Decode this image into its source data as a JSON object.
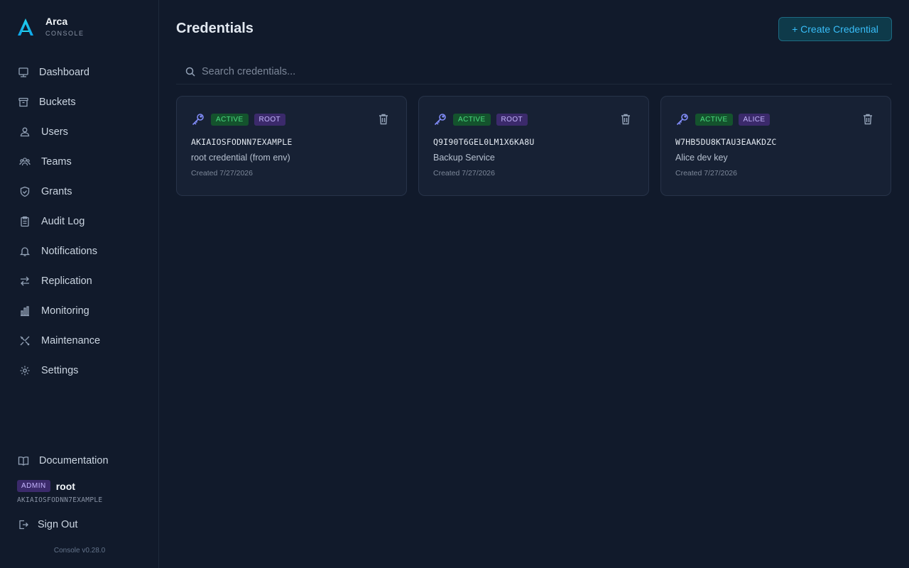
{
  "brand": {
    "name": "Arca",
    "subtitle": "CONSOLE"
  },
  "nav": {
    "items": [
      {
        "label": "Dashboard",
        "icon": "dashboard-icon"
      },
      {
        "label": "Buckets",
        "icon": "archive-icon"
      },
      {
        "label": "Users",
        "icon": "user-icon"
      },
      {
        "label": "Teams",
        "icon": "teams-icon"
      },
      {
        "label": "Grants",
        "icon": "shield-check-icon"
      },
      {
        "label": "Audit Log",
        "icon": "clipboard-icon"
      },
      {
        "label": "Notifications",
        "icon": "bell-icon"
      },
      {
        "label": "Replication",
        "icon": "arrows-icon"
      },
      {
        "label": "Monitoring",
        "icon": "bar-chart-icon"
      },
      {
        "label": "Maintenance",
        "icon": "tools-icon"
      },
      {
        "label": "Settings",
        "icon": "gear-icon"
      }
    ]
  },
  "footer": {
    "documentation": "Documentation",
    "role_badge": "ADMIN",
    "user_name": "root",
    "user_key": "AKIAIOSFODNN7EXAMPLE",
    "sign_out": "Sign Out",
    "version": "Console v0.28.0"
  },
  "header": {
    "title": "Credentials",
    "create_button": "+ Create Credential"
  },
  "search": {
    "placeholder": "Search credentials...",
    "value": ""
  },
  "credentials": [
    {
      "status": "ACTIVE",
      "owner": "ROOT",
      "access_key": "AKIAIOSFODNN7EXAMPLE",
      "description": "root credential (from env)",
      "created": "Created 7/27/2026"
    },
    {
      "status": "ACTIVE",
      "owner": "ROOT",
      "access_key": "Q9I90T6GEL0LM1X6KA8U",
      "description": "Backup Service",
      "created": "Created 7/27/2026"
    },
    {
      "status": "ACTIVE",
      "owner": "ALICE",
      "access_key": "W7HB5DU8KTAU3EAAKDZC",
      "description": "Alice dev key",
      "created": "Created 7/27/2026"
    }
  ],
  "colors": {
    "accent": "#38bdf8",
    "key_icon": "#818cf8",
    "active_badge": "#4ade80",
    "owner_badge": "#c4b5fd"
  }
}
